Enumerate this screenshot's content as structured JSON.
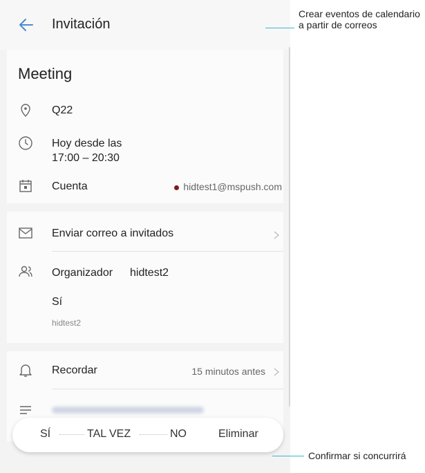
{
  "appbar": {
    "title": "Invitación"
  },
  "event": {
    "title": "Meeting",
    "location": "Q22",
    "time_line1": "Hoy desde las",
    "time_line2": "17:00 – 20:30",
    "account_label": "Cuenta",
    "account_value": "hidtest1@mspush.com"
  },
  "guests": {
    "email_label": "Enviar correo a invitados",
    "organizer_label": "Organizador",
    "organizer_name": "hidtest2",
    "response": "Sí",
    "response_user": "hidtest2"
  },
  "reminder": {
    "label": "Recordar",
    "value": "15 minutos antes"
  },
  "actions": {
    "yes": "SÍ",
    "maybe": "TAL VEZ",
    "no": "NO",
    "delete": "Eliminar"
  },
  "callouts": {
    "top": "Crear eventos de calendario a partir de correos",
    "bottom": "Confirmar si concurrirá"
  },
  "colors": {
    "accent": "#4a8ad4",
    "callout_line": "#3bb7c2",
    "account_dot": "#7a1d1d"
  }
}
